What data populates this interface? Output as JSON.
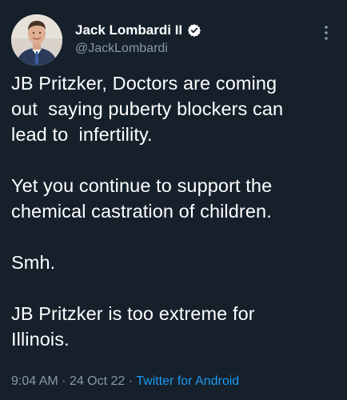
{
  "author": {
    "display_name": "Jack Lombardi II",
    "handle": "@JackLombardi",
    "verified": true,
    "avatar_icon": "profile-photo",
    "verified_icon": "verified-badge-icon"
  },
  "tweet": {
    "text": "JB Pritzker, Doctors are coming\nout  saying puberty blockers can\nlead to  infertility.\n\nYet you continue to support the\nchemical castration of children.\n\nSmh.\n\nJB Pritzker is too extreme for\nIllinois.",
    "time": "9:04 AM",
    "date": "24 Oct 22",
    "separator": "·",
    "source": "Twitter for Android"
  },
  "colors": {
    "background": "#15202b",
    "text_primary": "#ffffff",
    "text_secondary": "#8b98a5",
    "accent": "#1d9bf0"
  }
}
